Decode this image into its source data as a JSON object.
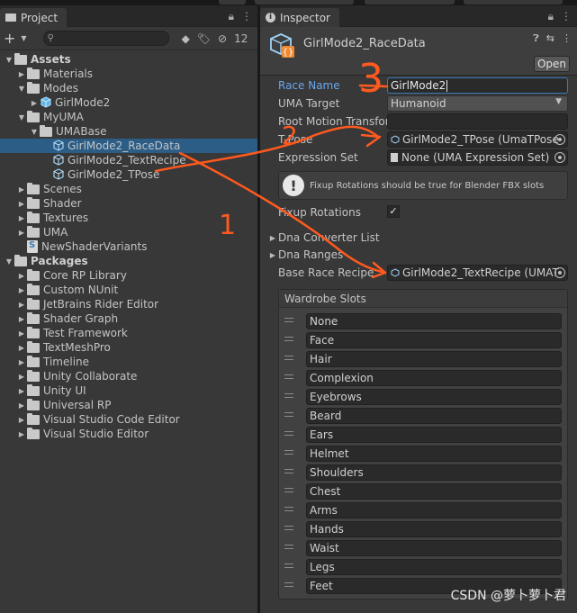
{
  "project": {
    "tab_label": "Project",
    "search_placeholder": "",
    "hidden_count": "12",
    "tree": [
      {
        "label": "Assets",
        "depth": 0,
        "expanded": true,
        "kind": "folder",
        "bold": true
      },
      {
        "label": "Materials",
        "depth": 1,
        "expanded": false,
        "kind": "folder"
      },
      {
        "label": "Modes",
        "depth": 1,
        "expanded": true,
        "kind": "folder"
      },
      {
        "label": "GirlMode2",
        "depth": 2,
        "expanded": false,
        "kind": "model"
      },
      {
        "label": "MyUMA",
        "depth": 1,
        "expanded": true,
        "kind": "folder"
      },
      {
        "label": "UMABase",
        "depth": 2,
        "expanded": true,
        "kind": "folder"
      },
      {
        "label": "GirlMode2_RaceData",
        "depth": 3,
        "kind": "asset",
        "selected": true
      },
      {
        "label": "GirlMode2_TextRecipe",
        "depth": 3,
        "kind": "asset"
      },
      {
        "label": "GirlMode2_TPose",
        "depth": 3,
        "kind": "asset"
      },
      {
        "label": "Scenes",
        "depth": 1,
        "expanded": false,
        "kind": "folder"
      },
      {
        "label": "Shader",
        "depth": 1,
        "expanded": false,
        "kind": "folder"
      },
      {
        "label": "Textures",
        "depth": 1,
        "expanded": false,
        "kind": "folder"
      },
      {
        "label": "UMA",
        "depth": 1,
        "expanded": false,
        "kind": "folder"
      },
      {
        "label": "NewShaderVariants",
        "depth": 1,
        "kind": "shader"
      },
      {
        "label": "Packages",
        "depth": 0,
        "expanded": true,
        "kind": "folder",
        "bold": true
      },
      {
        "label": "Core RP Library",
        "depth": 1,
        "expanded": false,
        "kind": "folder"
      },
      {
        "label": "Custom NUnit",
        "depth": 1,
        "expanded": false,
        "kind": "folder"
      },
      {
        "label": "JetBrains Rider Editor",
        "depth": 1,
        "expanded": false,
        "kind": "folder"
      },
      {
        "label": "Shader Graph",
        "depth": 1,
        "expanded": false,
        "kind": "folder"
      },
      {
        "label": "Test Framework",
        "depth": 1,
        "expanded": false,
        "kind": "folder"
      },
      {
        "label": "TextMeshPro",
        "depth": 1,
        "expanded": false,
        "kind": "folder"
      },
      {
        "label": "Timeline",
        "depth": 1,
        "expanded": false,
        "kind": "folder"
      },
      {
        "label": "Unity Collaborate",
        "depth": 1,
        "expanded": false,
        "kind": "folder"
      },
      {
        "label": "Unity UI",
        "depth": 1,
        "expanded": false,
        "kind": "folder"
      },
      {
        "label": "Universal RP",
        "depth": 1,
        "expanded": false,
        "kind": "folder"
      },
      {
        "label": "Visual Studio Code Editor",
        "depth": 1,
        "expanded": false,
        "kind": "folder"
      },
      {
        "label": "Visual Studio Editor",
        "depth": 1,
        "expanded": false,
        "kind": "folder"
      }
    ]
  },
  "inspector": {
    "tab_label": "Inspector",
    "asset_title": "GirlMode2_RaceData",
    "open_label": "Open",
    "race_name_label": "Race Name",
    "race_name_value": "GirlMode2",
    "uma_target_label": "UMA Target",
    "uma_target_value": "Humanoid",
    "root_motion_label": "Root Motion Transfor",
    "root_motion_value": "",
    "tpose_label": "T-Pose",
    "tpose_value": "GirlMode2_TPose (UmaTPose",
    "expression_label": "Expression Set",
    "expression_value": "None (UMA Expression Set)",
    "help_text": "Fixup Rotations should be true for Blender FBX slots",
    "fixup_label": "Fixup Rotations",
    "fixup_checked": "✓",
    "dna_converter_label": "Dna Converter List",
    "dna_ranges_label": "Dna Ranges",
    "base_recipe_label": "Base Race Recipe",
    "base_recipe_value": "GirlMode2_TextRecipe (UMAT",
    "wardrobe_label": "Wardrobe Slots",
    "wardrobe_slots": [
      "None",
      "Face",
      "Hair",
      "Complexion",
      "Eyebrows",
      "Beard",
      "Ears",
      "Helmet",
      "Shoulders",
      "Chest",
      "Arms",
      "Hands",
      "Waist",
      "Legs",
      "Feet"
    ]
  },
  "annotations": {
    "labels": [
      "3",
      "2",
      "1"
    ],
    "color": "#ff5a1f"
  },
  "watermark": "CSDN @萝卜萝卜君",
  "colors": {
    "panel_bg": "#383838",
    "field_bg": "#2a2a2a",
    "selection": "#2c5d87",
    "active_label": "#6aa6ec",
    "focus_border": "#3a79bb"
  }
}
